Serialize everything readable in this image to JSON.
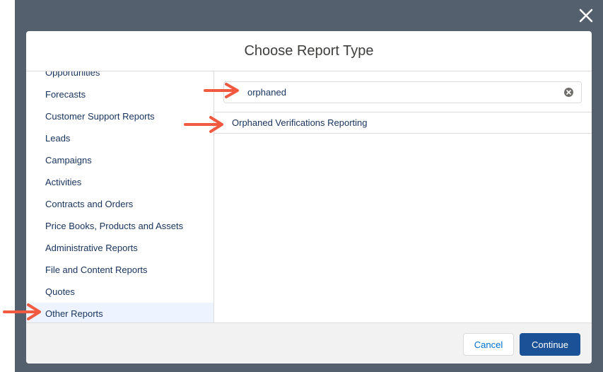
{
  "modal": {
    "title": "Choose Report Type"
  },
  "categories": [
    "Opportunities",
    "Forecasts",
    "Customer Support Reports",
    "Leads",
    "Campaigns",
    "Activities",
    "Contracts and Orders",
    "Price Books, Products and Assets",
    "Administrative Reports",
    "File and Content Reports",
    "Quotes",
    "Other Reports"
  ],
  "selected_category": "Other Reports",
  "search": {
    "value": "orphaned",
    "placeholder": ""
  },
  "results": [
    "Orphaned Verifications Reporting"
  ],
  "footer": {
    "cancel_label": "Cancel",
    "continue_label": "Continue"
  },
  "icons": {
    "close": "close-icon",
    "clear": "clear-search-icon",
    "annotation": "arrow-right-icon"
  },
  "colors": {
    "backdrop": "#54606e",
    "text": "#16325c",
    "selected_bg": "#eef4ff",
    "primary_button": "#1b5297",
    "link": "#0070d2",
    "annotation_arrow": "#f15a40"
  }
}
